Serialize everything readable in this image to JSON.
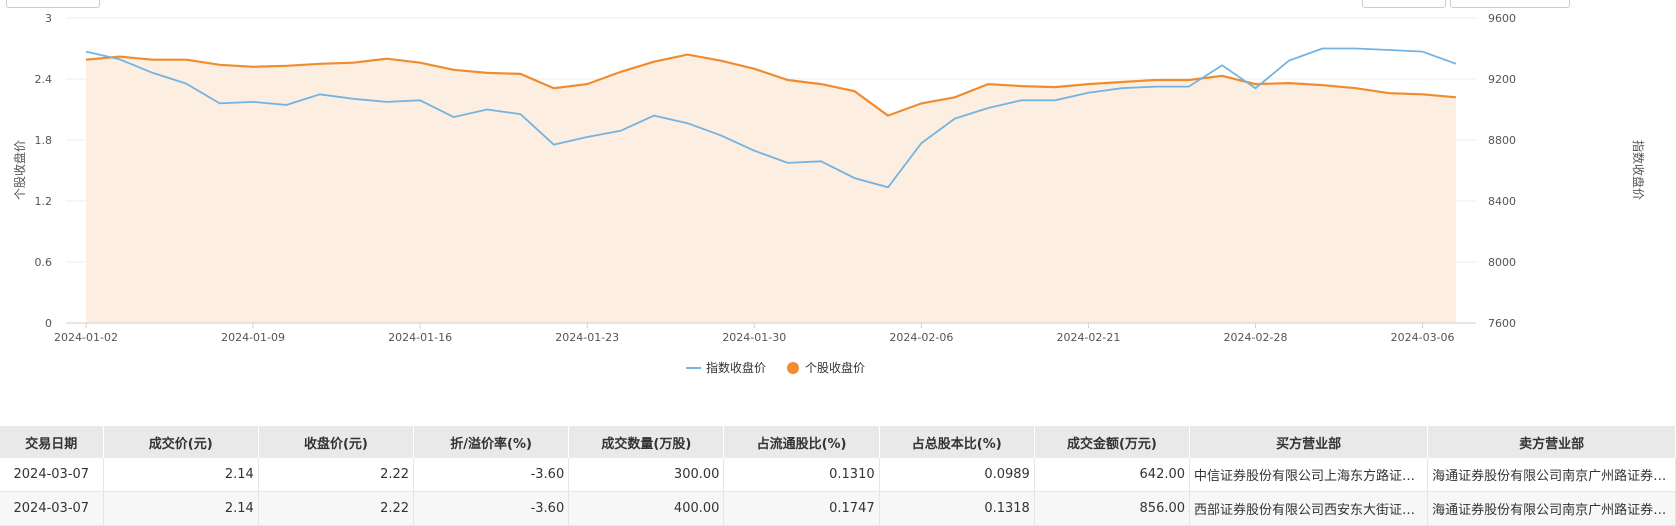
{
  "chart_data": {
    "type": "line",
    "x": [
      "2024-01-02",
      "2024-01-03",
      "2024-01-04",
      "2024-01-05",
      "2024-01-08",
      "2024-01-09",
      "2024-01-10",
      "2024-01-11",
      "2024-01-12",
      "2024-01-15",
      "2024-01-16",
      "2024-01-17",
      "2024-01-18",
      "2024-01-19",
      "2024-01-22",
      "2024-01-23",
      "2024-01-24",
      "2024-01-25",
      "2024-01-26",
      "2024-01-29",
      "2024-01-30",
      "2024-01-31",
      "2024-02-01",
      "2024-02-02",
      "2024-02-05",
      "2024-02-06",
      "2024-02-07",
      "2024-02-08",
      "2024-02-19",
      "2024-02-20",
      "2024-02-21",
      "2024-02-22",
      "2024-02-23",
      "2024-02-26",
      "2024-02-27",
      "2024-02-28",
      "2024-02-29",
      "2024-03-01",
      "2024-03-04",
      "2024-03-05",
      "2024-03-06",
      "2024-03-07"
    ],
    "x_ticks": [
      "2024-01-02",
      "2024-01-09",
      "2024-01-16",
      "2024-01-23",
      "2024-01-30",
      "2024-02-06",
      "2024-02-21",
      "2024-02-28",
      "2024-03-06"
    ],
    "series": [
      {
        "name": "指数收盘价",
        "axis": "right",
        "color": "#73b4e0",
        "values": [
          9380,
          9330,
          9240,
          9170,
          9040,
          9050,
          9030,
          9100,
          9070,
          9050,
          9060,
          8950,
          9000,
          8970,
          8770,
          8820,
          8860,
          8960,
          8910,
          8830,
          8730,
          8650,
          8660,
          8550,
          8490,
          8780,
          8940,
          9010,
          9060,
          9060,
          9110,
          9140,
          9150,
          9150,
          9290,
          9140,
          9320,
          9400,
          9400,
          9390,
          9380,
          9300
        ]
      },
      {
        "name": "个股收盘价",
        "axis": "left",
        "color": "#f08c2e",
        "values": [
          2.59,
          2.62,
          2.59,
          2.59,
          2.54,
          2.52,
          2.53,
          2.55,
          2.56,
          2.6,
          2.56,
          2.49,
          2.46,
          2.45,
          2.31,
          2.35,
          2.47,
          2.57,
          2.64,
          2.58,
          2.5,
          2.39,
          2.35,
          2.28,
          2.04,
          2.16,
          2.22,
          2.35,
          2.33,
          2.32,
          2.35,
          2.37,
          2.39,
          2.39,
          2.43,
          2.35,
          2.36,
          2.34,
          2.31,
          2.26,
          2.25,
          2.22
        ]
      }
    ],
    "y_left": {
      "label": "个股收盘价",
      "ticks": [
        "0",
        "0.6",
        "1.2",
        "1.8",
        "2.4",
        "3"
      ],
      "lim": [
        0,
        3
      ]
    },
    "y_right": {
      "label": "指数收盘价",
      "ticks": [
        "7600",
        "8000",
        "8400",
        "8800",
        "9200",
        "9600"
      ],
      "lim": [
        7600,
        9600
      ]
    },
    "area_fill": "#fdeee2",
    "grid": true,
    "legend_position": "bottom-center"
  },
  "table": {
    "headers": [
      "交易日期",
      "成交价(元)",
      "收盘价(元)",
      "折/溢价率(%)",
      "成交数量(万股)",
      "占流通股比(%)",
      "占总股本比(%)",
      "成交金额(万元)",
      "买方营业部",
      "卖方营业部"
    ],
    "rows": [
      [
        "2024-03-07",
        "2.14",
        "2.22",
        "-3.60",
        "300.00",
        "0.1310",
        "0.0989",
        "642.00",
        "中信证券股份有限公司上海东方路证券营业部",
        "海通证券股份有限公司南京广州路证券营业部"
      ],
      [
        "2024-03-07",
        "2.14",
        "2.22",
        "-3.60",
        "400.00",
        "0.1747",
        "0.1318",
        "856.00",
        "西部证券股份有限公司西安东大街证券营业部",
        "海通证券股份有限公司南京广州路证券营业部"
      ]
    ]
  }
}
